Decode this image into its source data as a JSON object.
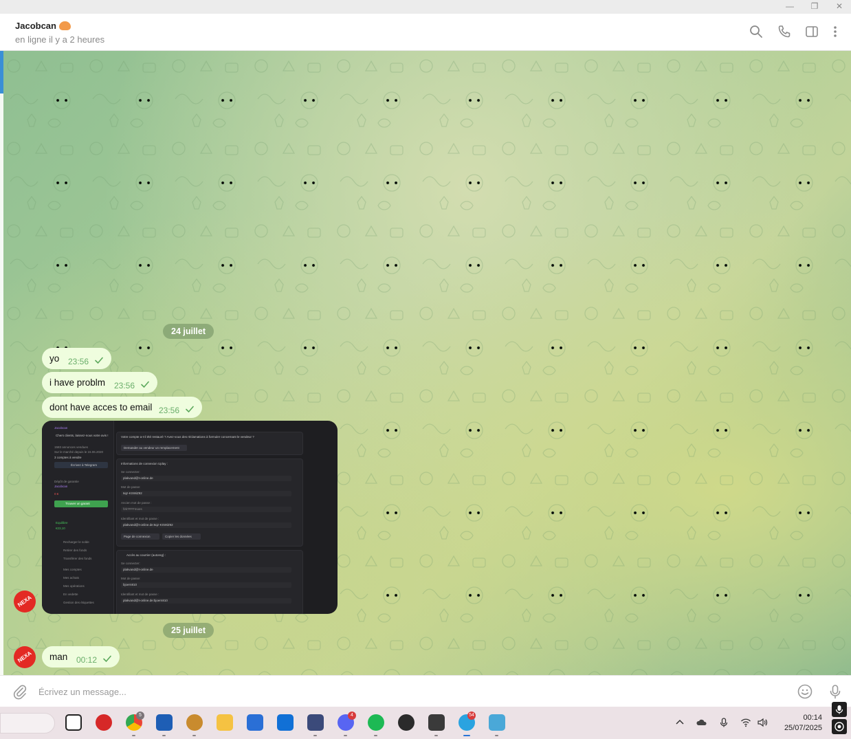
{
  "window": {
    "minimize": "—",
    "restore": "❐",
    "close": "✕"
  },
  "header": {
    "contact_name": "Jacobcan",
    "status": "en ligne il y a 2 heures",
    "icons": [
      "search-icon",
      "phone-icon",
      "sidebar-toggle-icon",
      "more-vert-icon"
    ]
  },
  "chat": {
    "date_1": "24 juillet",
    "date_2": "25 juillet",
    "messages": [
      {
        "text": "yo",
        "time": "23:56"
      },
      {
        "text": "i have problm",
        "time": "23:56"
      },
      {
        "text": "dont have acces to email",
        "time": "23:56"
      },
      {
        "text": "man",
        "time": "00:12"
      }
    ],
    "avatar_label": "NEXA",
    "accent_color": "#3a8fd6",
    "bubble_color": "#effdde"
  },
  "screenshot": {
    "side": {
      "seller": "Jacobcan",
      "greeting": "Chers clients, laissez-nous votre avis !",
      "sold": "1583 annonces vendues",
      "since": "Sur le marché depuis le 15.06.2020",
      "accounts": "3 comptes à vendre",
      "telegram_btn": "Écrivez à Telegram",
      "guarantee_title": "Dépôt de garantie",
      "guarantee_user": "Jacobcan",
      "guarantee_amount": "0 €",
      "guarantee_btn": "Trouver un garant",
      "balance_label": "Equilibre",
      "balance_value": "€23,10",
      "menu": [
        "Recharger le solde",
        "Retirer des fonds",
        "Transférer des fonds",
        "Mes comptes",
        "Mes achats",
        "Mes opérations",
        "En vedette",
        "Gestion des étiquettes"
      ]
    },
    "main": {
      "question": "Votre compte a-t-il été restauré ? Avez-vous des réclamations à formuler concernant le vendeur ?",
      "replace_btn": "Demander au vendeur un remplacement",
      "uplay_title": "Informations de connexion Uplay :",
      "login_label": "Se connecter:",
      "login_value": "plakvand@t-online.de",
      "password_label": "Mot de passe:",
      "password_value": "6qz-KSWiZ92",
      "old_password_label": "Ancien mot de passe :",
      "old_password_value": "f2k7FFFmoes",
      "combo_label": "Identifiant et mot de passe :",
      "combo_value": "plakvand@t-online.de:6qz-KSWiZ92",
      "login_page_btn": "Page de connexion",
      "copy_btn": "Copier les données",
      "mail_title": "Accès au courrier (autoreg) :",
      "mail_login_label": "Se connecter:",
      "mail_login_value": "plakvand@t-online.de",
      "mail_password_label": "Mot de passe:",
      "mail_password_value": "bjoern810",
      "mail_combo_label": "Identifiant et mot de passe :",
      "mail_combo_value": "plakvand@t-online.de:bjoern810"
    }
  },
  "composer": {
    "placeholder": "Écrivez un message..."
  },
  "taskbar": {
    "badges": {
      "chrome": "5",
      "discord": "4",
      "telegram": "54"
    },
    "time": "00:14",
    "date": "25/07/2025"
  }
}
